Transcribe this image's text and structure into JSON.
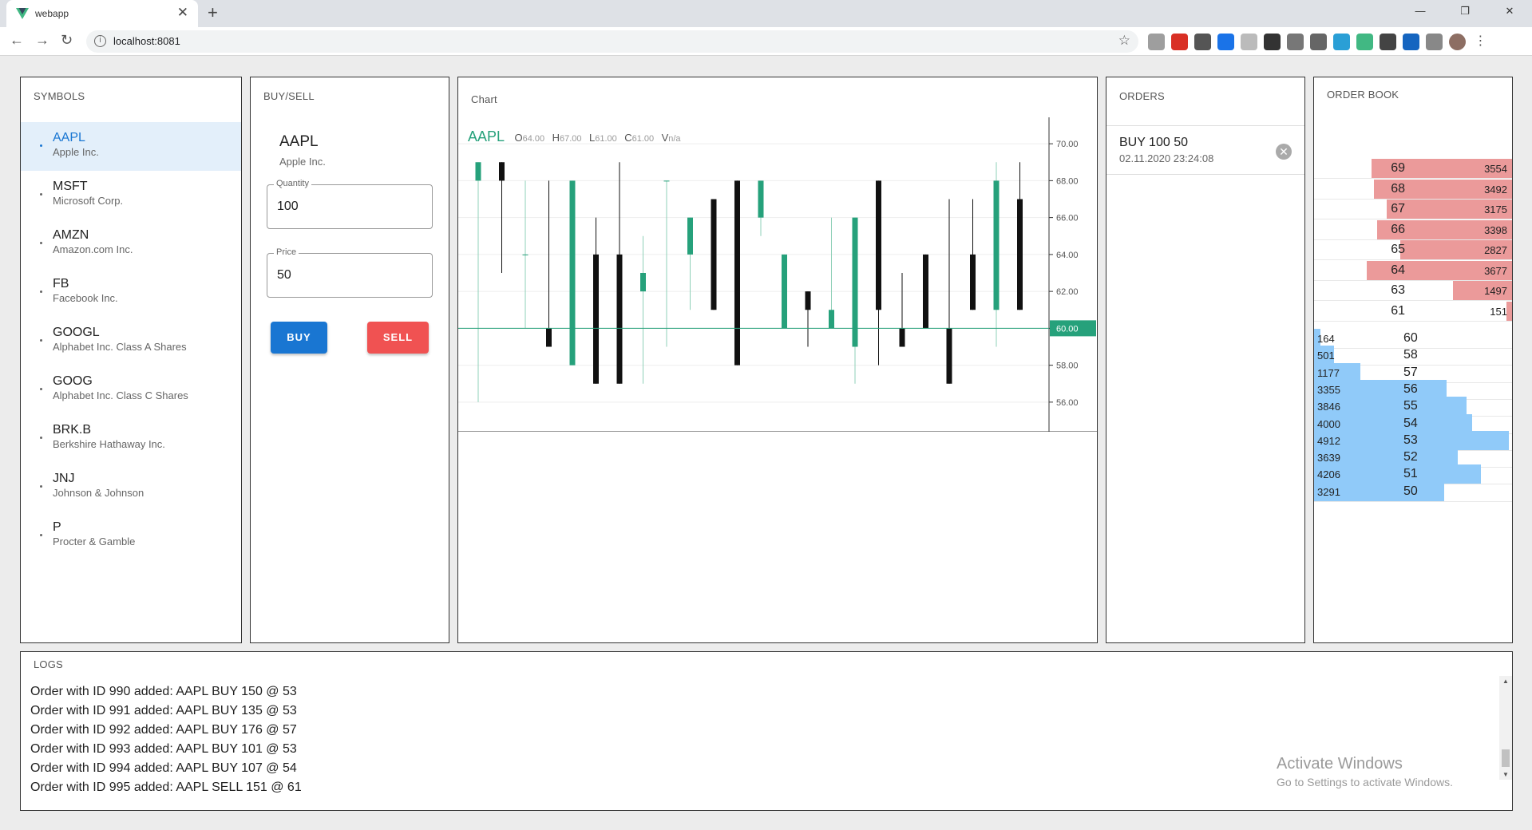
{
  "browser": {
    "tab_title": "webapp",
    "url": "localhost:8081"
  },
  "symbols": {
    "title": "SYMBOLS",
    "items": [
      {
        "ticker": "AAPL",
        "name": "Apple Inc.",
        "active": true
      },
      {
        "ticker": "MSFT",
        "name": "Microsoft Corp."
      },
      {
        "ticker": "AMZN",
        "name": "Amazon.com Inc."
      },
      {
        "ticker": "FB",
        "name": "Facebook Inc."
      },
      {
        "ticker": "GOOGL",
        "name": "Alphabet Inc. Class A Shares"
      },
      {
        "ticker": "GOOG",
        "name": "Alphabet Inc. Class C Shares"
      },
      {
        "ticker": "BRK.B",
        "name": "Berkshire Hathaway Inc."
      },
      {
        "ticker": "JNJ",
        "name": "Johnson & Johnson"
      },
      {
        "ticker": "P",
        "name": "Procter & Gamble"
      }
    ]
  },
  "buysell": {
    "title": "BUY/SELL",
    "symbol": "AAPL",
    "name": "Apple Inc.",
    "quantity_label": "Quantity",
    "quantity": "100",
    "price_label": "Price",
    "price": "50",
    "buy_label": "BUY",
    "sell_label": "SELL",
    "buy_color": "#1976d2",
    "sell_color": "#f05252"
  },
  "chart": {
    "title": "Chart",
    "legend": {
      "symbol": "AAPL",
      "o_key": "O",
      "o": "64.00",
      "h_key": "H",
      "h": "67.00",
      "l_key": "L",
      "l": "61.00",
      "c_key": "C",
      "c": "61.00",
      "v_key": "V",
      "v": "n/a"
    },
    "last_price": "60.00",
    "up_color": "#26a17b",
    "down_color": "#111111"
  },
  "chart_data": {
    "type": "candlestick",
    "ylim": [
      55,
      71
    ],
    "y_ticks": [
      "70.00",
      "68.00",
      "66.00",
      "64.00",
      "62.00",
      "60.00",
      "58.00",
      "56.00"
    ],
    "last_price": 60,
    "candles": [
      {
        "o": 68,
        "h": 69,
        "l": 56,
        "c": 69
      },
      {
        "o": 69,
        "h": 69,
        "l": 63,
        "c": 68
      },
      {
        "o": 64,
        "h": 68,
        "l": 60,
        "c": 64
      },
      {
        "o": 60,
        "h": 68,
        "l": 59,
        "c": 59
      },
      {
        "o": 58,
        "h": 68,
        "l": 58,
        "c": 68
      },
      {
        "o": 64,
        "h": 66,
        "l": 57,
        "c": 57
      },
      {
        "o": 64,
        "h": 69,
        "l": 57,
        "c": 57
      },
      {
        "o": 62,
        "h": 65,
        "l": 57,
        "c": 63
      },
      {
        "o": 68,
        "h": 68,
        "l": 59,
        "c": 68
      },
      {
        "o": 64,
        "h": 66,
        "l": 61,
        "c": 66
      },
      {
        "o": 67,
        "h": 67,
        "l": 61,
        "c": 61
      },
      {
        "o": 68,
        "h": 68,
        "l": 58,
        "c": 58
      },
      {
        "o": 66,
        "h": 68,
        "l": 65,
        "c": 68
      },
      {
        "o": 60,
        "h": 64,
        "l": 60,
        "c": 64
      },
      {
        "o": 62,
        "h": 62,
        "l": 59,
        "c": 61
      },
      {
        "o": 60,
        "h": 66,
        "l": 60,
        "c": 61
      },
      {
        "o": 59,
        "h": 66,
        "l": 57,
        "c": 66
      },
      {
        "o": 68,
        "h": 68,
        "l": 58,
        "c": 61
      },
      {
        "o": 60,
        "h": 63,
        "l": 59,
        "c": 59
      },
      {
        "o": 64,
        "h": 64,
        "l": 60,
        "c": 60
      },
      {
        "o": 60,
        "h": 67,
        "l": 57,
        "c": 57
      },
      {
        "o": 64,
        "h": 67,
        "l": 61,
        "c": 61
      },
      {
        "o": 61,
        "h": 69,
        "l": 59,
        "c": 68
      },
      {
        "o": 67,
        "h": 69,
        "l": 61,
        "c": 61
      }
    ]
  },
  "orders": {
    "title": "ORDERS",
    "items": [
      {
        "line1": "BUY 100 50",
        "line2": "02.11.2020 23:24:08"
      }
    ]
  },
  "orderbook": {
    "title": "ORDER BOOK",
    "ask_color": "#eb9a9a",
    "bid_color": "#90caf9",
    "max_qty": 5000,
    "asks": [
      {
        "price": "69",
        "qty": "3554",
        "q": 3554
      },
      {
        "price": "68",
        "qty": "3492",
        "q": 3492
      },
      {
        "price": "67",
        "qty": "3175",
        "q": 3175
      },
      {
        "price": "66",
        "qty": "3398",
        "q": 3398
      },
      {
        "price": "65",
        "qty": "2827",
        "q": 2827
      },
      {
        "price": "64",
        "qty": "3677",
        "q": 3677
      },
      {
        "price": "63",
        "qty": "1497",
        "q": 1497
      },
      {
        "price": "61",
        "qty": "151",
        "q": 151
      }
    ],
    "bids": [
      {
        "price": "60",
        "qty": "164",
        "q": 164
      },
      {
        "price": "58",
        "qty": "501",
        "q": 501
      },
      {
        "price": "57",
        "qty": "1177",
        "q": 1177
      },
      {
        "price": "56",
        "qty": "3355",
        "q": 3355
      },
      {
        "price": "55",
        "qty": "3846",
        "q": 3846
      },
      {
        "price": "54",
        "qty": "4000",
        "q": 4000
      },
      {
        "price": "53",
        "qty": "4912",
        "q": 4912
      },
      {
        "price": "52",
        "qty": "3639",
        "q": 3639
      },
      {
        "price": "51",
        "qty": "4206",
        "q": 4206
      },
      {
        "price": "50",
        "qty": "3291",
        "q": 3291
      }
    ]
  },
  "logs": {
    "title": "LOGS",
    "lines": [
      "Order with ID 990 added: AAPL BUY 150 @ 53",
      "Order with ID 991 added: AAPL BUY 135 @ 53",
      "Order with ID 992 added: AAPL BUY 176 @ 57",
      "Order with ID 993 added: AAPL BUY 101 @ 53",
      "Order with ID 994 added: AAPL BUY 107 @ 54",
      "Order with ID 995 added: AAPL SELL 151 @ 61"
    ]
  },
  "watermark": {
    "line1": "Activate Windows",
    "line2": "Go to Settings to activate Windows."
  }
}
